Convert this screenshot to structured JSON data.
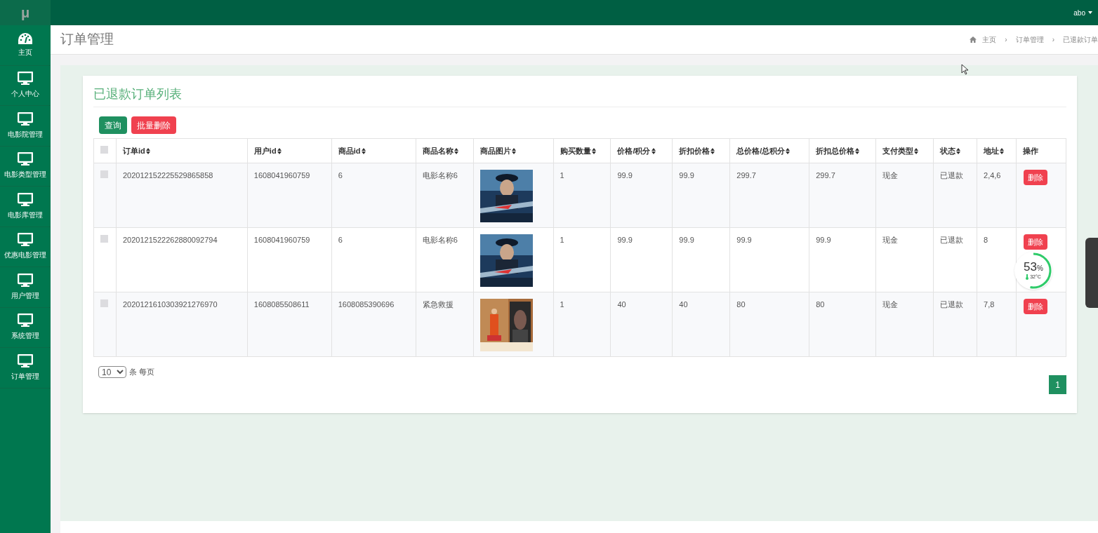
{
  "logo": "μ",
  "user_menu": {
    "label": "abo"
  },
  "sidebar": {
    "items": [
      {
        "label": "主页",
        "selected": false
      },
      {
        "label": "个人中心",
        "selected": false
      },
      {
        "label": "电影院管理",
        "selected": false
      },
      {
        "label": "电影类型管理",
        "selected": false
      },
      {
        "label": "电影库管理",
        "selected": false
      },
      {
        "label": "优惠电影管理",
        "selected": false
      },
      {
        "label": "用户管理",
        "selected": false
      },
      {
        "label": "系统管理",
        "selected": false
      },
      {
        "label": "订单管理",
        "selected": false
      }
    ]
  },
  "page_title": "订单管理",
  "breadcrumb": [
    {
      "label": "主页",
      "kind": "link"
    },
    {
      "label": "›",
      "kind": "separator"
    },
    {
      "label": "订单管理",
      "kind": "link"
    },
    {
      "label": "›",
      "kind": "separator"
    },
    {
      "label": "已退款订单",
      "kind": "link"
    }
  ],
  "card": {
    "title": "已退款订单列表",
    "buttons": [
      {
        "label": "查询",
        "kind": "primary"
      },
      {
        "label": "批量删除",
        "kind": "danger"
      }
    ],
    "table": {
      "columns": [
        {
          "label": "订单id",
          "sortable": true
        },
        {
          "label": "用户id",
          "sortable": true
        },
        {
          "label": "商品id",
          "sortable": true
        },
        {
          "label": "商品名称",
          "sortable": true
        },
        {
          "label": "商品图片",
          "sortable": true
        },
        {
          "label": "购买数量",
          "sortable": true
        },
        {
          "label": "价格/积分",
          "sortable": true
        },
        {
          "label": "折扣价格",
          "sortable": true
        },
        {
          "label": "总价格/总积分",
          "sortable": true
        },
        {
          "label": "折扣总价格",
          "sortable": true
        },
        {
          "label": "支付类型",
          "sortable": true
        },
        {
          "label": "状态",
          "sortable": true
        },
        {
          "label": "地址",
          "sortable": true
        },
        {
          "label": "操作",
          "sortable": false
        }
      ],
      "header_checked": false,
      "rows": [
        {
          "checked": false,
          "cells": [
            "202012152225529865858",
            "1608041960759",
            "6",
            "电影名称6",
            null,
            "1",
            "99.9",
            "99.9",
            "299.7",
            "299.7",
            "现金",
            "已退款",
            "2,4,6"
          ],
          "action": "删除"
        },
        {
          "checked": false,
          "cells": [
            "2020121522262880092794",
            "1608041960759",
            "6",
            "电影名称6",
            null,
            "1",
            "99.9",
            "99.9",
            "99.9",
            "99.9",
            "现金",
            "已退款",
            "8"
          ],
          "action": "删除"
        },
        {
          "checked": false,
          "cells": [
            "2020121610303921276970",
            "1608085508611",
            "1608085390696",
            "紧急救援",
            null,
            "1",
            "40",
            "40",
            "80",
            "80",
            "现金",
            "已退款",
            "7,8"
          ],
          "action": "删除"
        }
      ]
    },
    "page_size": "10",
    "page_size_label": "条 每页",
    "pages": [
      {
        "label": "1",
        "selected": true
      }
    ]
  },
  "monitor_widget": {
    "percent": "53",
    "unit": "%",
    "temperature": "32°C",
    "level": 0.53
  }
}
